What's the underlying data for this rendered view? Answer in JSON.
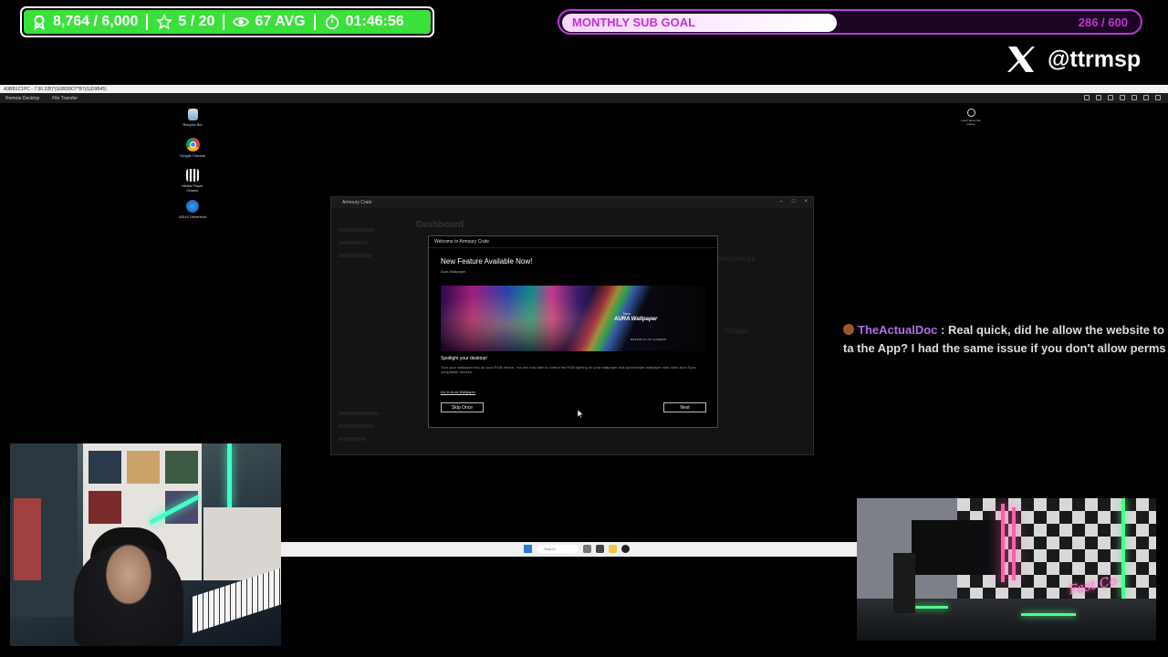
{
  "stats": {
    "followers": "8,764 / 6,000",
    "subs": "5 / 20",
    "viewers": "67 AVG",
    "uptime": "01:46:56"
  },
  "sub_goal": {
    "label": "MONTHLY SUB GOAL",
    "count": "286 / 600",
    "progress": 0.477,
    "color": "#b93bd8"
  },
  "social": {
    "handle": "@ttrmsp",
    "icon": "x-logo-icon"
  },
  "remote_desktop": {
    "title": "A9BB1C1PC - 7.50.2(B)*(G0BD8O7*B7(G)D9B45)",
    "menu": [
      "Remote Desktop",
      "File Transfer"
    ]
  },
  "desktop_icons": [
    {
      "label": "Recycle Bin",
      "icon": "recycle-bin-icon"
    },
    {
      "label": "Google Chrome",
      "icon": "chrome-icon"
    },
    {
      "label": "Media Player Classic",
      "icon": "media-player-icon"
    },
    {
      "label": "ASUS DriverHub",
      "icon": "asus-driverhub-icon"
    }
  ],
  "desktop_icon_right": {
    "label": "Learn about this picture",
    "icon": "learn-icon"
  },
  "armoury_crate": {
    "window_title": "Armoury Crate",
    "dashboard_label": "Dashboard",
    "temperature_label": "Temperature",
    "voltage_label": "Voltage"
  },
  "welcome_dialog": {
    "title": "Welcome to Armoury Crate",
    "heading": "New Feature Available Now!",
    "subheading": "Aura Wallpaper",
    "banner_new": "New",
    "banner_title": "AURA Wallpaper",
    "banner_brand": "REPUBLIC OF GAMERS",
    "spotlight": "Spotlight your desktop!",
    "body": "Turn your wallpaper into an Aura RGB device. You are now able to control the RGB lighting on your wallpaper and synchronize wallpaper with other Aura Sync compatible devices.",
    "link": "Go to Aura Wallpaper",
    "skip_button": "Skip Once",
    "next_button": "Next"
  },
  "chat": {
    "user": "TheActualDoc",
    "message": " : Real quick, did he allow the website to ta the App? I had the same issue if you don't allow perms"
  },
  "taskbar": {
    "search_placeholder": "Search"
  }
}
